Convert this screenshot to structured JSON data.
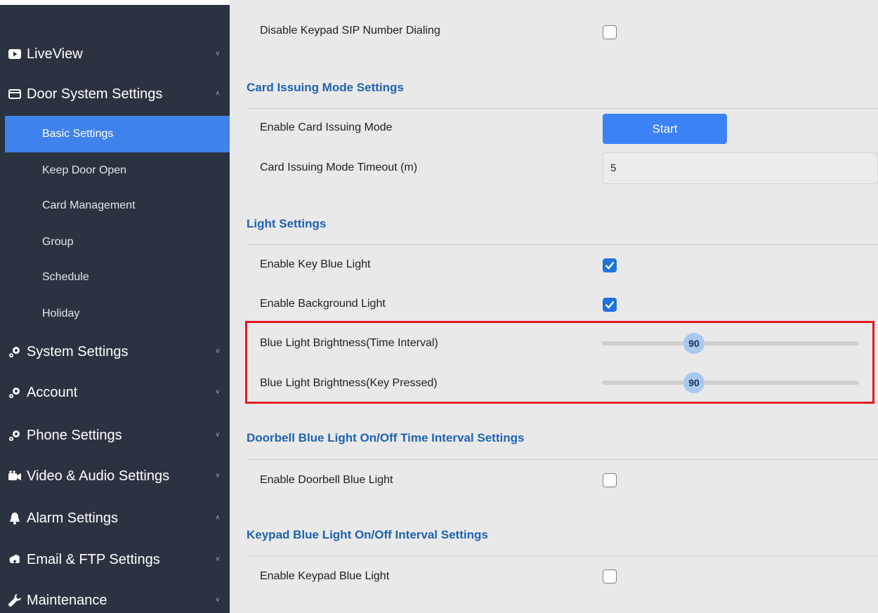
{
  "sidebar": {
    "nav": [
      {
        "label": "LiveView",
        "icon": "video-play-icon",
        "chevron": "˅"
      },
      {
        "label": "Door System Settings",
        "icon": "door-card-icon",
        "chevron": "˄"
      },
      {
        "label": "System Settings",
        "icon": "gears-icon",
        "chevron": "˅"
      },
      {
        "label": "Account",
        "icon": "gears-icon",
        "chevron": "˅"
      },
      {
        "label": "Phone Settings",
        "icon": "gears-icon",
        "chevron": "˅"
      },
      {
        "label": "Video & Audio Settings",
        "icon": "camera-icon",
        "chevron": "˅"
      },
      {
        "label": "Alarm Settings",
        "icon": "bell-icon",
        "chevron": "˄"
      },
      {
        "label": "Email & FTP Settings",
        "icon": "cloud-icon",
        "chevron": "˅"
      },
      {
        "label": "Maintenance",
        "icon": "wrench-icon",
        "chevron": "˅"
      }
    ],
    "sub": [
      {
        "label": "Basic Settings",
        "active": true
      },
      {
        "label": "Keep Door Open"
      },
      {
        "label": "Card Management"
      },
      {
        "label": "Group"
      },
      {
        "label": "Schedule"
      },
      {
        "label": "Holiday"
      }
    ]
  },
  "main": {
    "keypad_sip_label": "Disable Keypad SIP Number Dialing",
    "card_issuing": {
      "title": "Card Issuing Mode Settings",
      "enable_label": "Enable Card Issuing Mode",
      "start_button": "Start",
      "timeout_label": "Card Issuing Mode Timeout (m)",
      "timeout_value": "5"
    },
    "light": {
      "title": "Light Settings",
      "key_blue_label": "Enable Key Blue Light",
      "background_label": "Enable Background Light",
      "brightness_interval_label": "Blue Light Brightness(Time Interval)",
      "brightness_interval_value": "90",
      "brightness_key_label": "Blue Light Brightness(Key Pressed)",
      "brightness_key_value": "90"
    },
    "doorbell": {
      "title": "Doorbell Blue Light On/Off Time Interval Settings",
      "enable_label": "Enable Doorbell Blue Light"
    },
    "keypad": {
      "title": "Keypad Blue Light On/Off Interval Settings",
      "enable_label": "Enable Keypad Blue Light"
    }
  },
  "colors": {
    "sidebar_bg": "#2c3340",
    "active_item": "#3f82ec",
    "section_title": "#1e63b0",
    "highlight": "#e21b23"
  }
}
